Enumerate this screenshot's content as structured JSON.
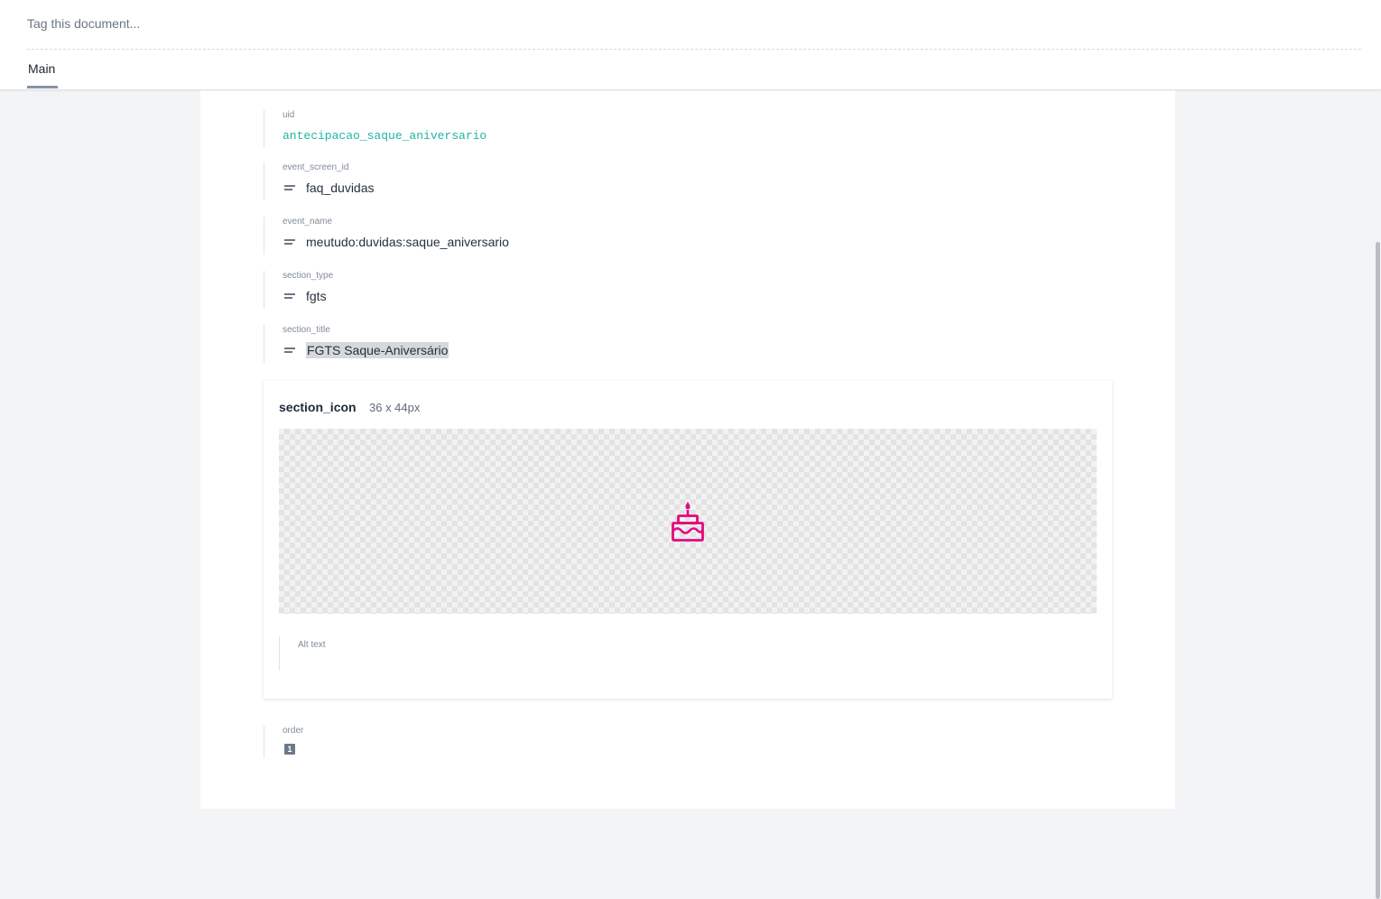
{
  "header": {
    "tag_placeholder": "Tag this document...",
    "tabs": [
      {
        "label": "Main",
        "active": true
      }
    ]
  },
  "fields": {
    "uid": {
      "label": "uid",
      "value": "antecipacao_saque_aniversario"
    },
    "event_screen_id": {
      "label": "event_screen_id",
      "value": "faq_duvidas"
    },
    "event_name": {
      "label": "event_name",
      "value": "meutudo:duvidas:saque_aniversario"
    },
    "section_type": {
      "label": "section_type",
      "value": "fgts"
    },
    "section_title": {
      "label": "section_title",
      "value": "FGTS Saque-Aniversário"
    },
    "section_icon": {
      "label": "section_icon",
      "dimensions": "36 x 44px",
      "icon": "birthday-cake-icon",
      "icon_color": "#e5097f",
      "alt_label": "Alt text",
      "alt_value": ""
    },
    "order": {
      "label": "order",
      "value": "1"
    }
  },
  "colors": {
    "uid_text": "#21b5a3",
    "panel_background": "#ffffff",
    "page_background": "#f3f4f6"
  }
}
